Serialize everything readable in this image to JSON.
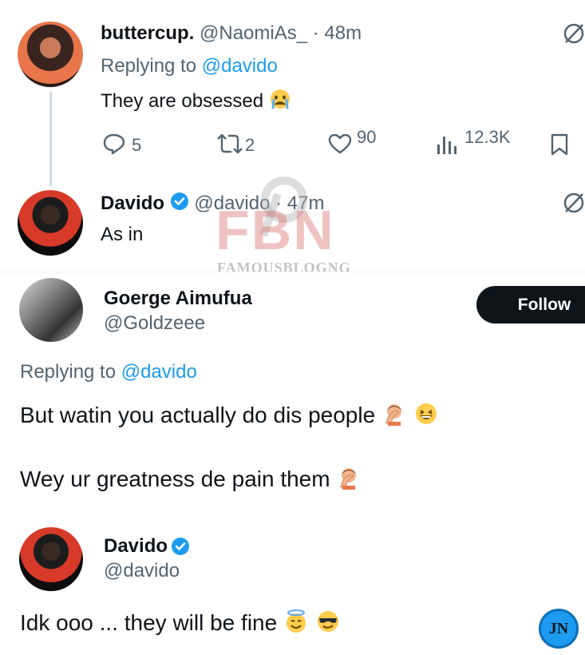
{
  "tweet1": {
    "name": "buttercup.",
    "handle": "@NaomiAs_",
    "time": "· 48m",
    "replying_prefix": "Replying to",
    "replying_handle": "@davido",
    "text": "They are obsessed",
    "stats": {
      "replies": "5",
      "retweets": "2",
      "likes": "90",
      "views": "12.3K"
    }
  },
  "tweet2": {
    "name": "Davido",
    "handle": "@davido",
    "time": "· 47m",
    "text": "As in"
  },
  "watermark": {
    "logo": "FBN",
    "site": "FAMOUSBLOGNG"
  },
  "tweet3": {
    "name": "Goerge Aimufua",
    "handle": "@Goldzeee",
    "follow_label": "Follow",
    "replying_prefix": "Replying to",
    "replying_handle": "@davido",
    "line1": "But watin you actually do dis people",
    "line2": "Wey ur greatness de pain them"
  },
  "tweet4": {
    "name": "Davido",
    "handle": "@davido",
    "text": "Idk ooo ... they will be fine"
  },
  "badge": {
    "text": "JN"
  },
  "colors": {
    "accent": "#1d9bf0",
    "text": "#0f1419",
    "muted": "#536471"
  }
}
